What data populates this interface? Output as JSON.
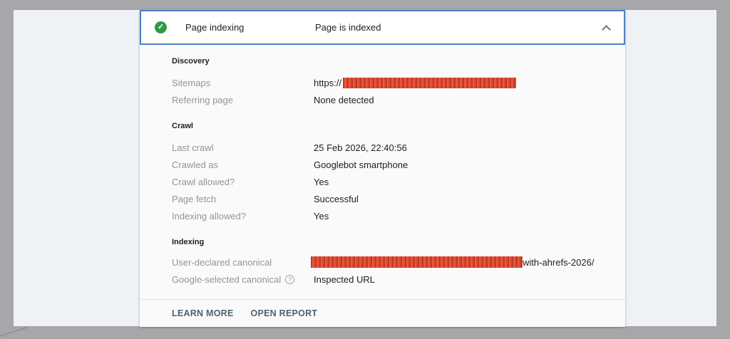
{
  "header": {
    "title": "Page indexing",
    "status": "Page is indexed",
    "check_icon_glyph": "✓",
    "colors": {
      "check_green": "#2d9a46",
      "border_blue": "#4e80c6"
    }
  },
  "sections": [
    {
      "heading": "Discovery",
      "rows": [
        {
          "label": "Sitemaps",
          "value_prefix": "https://",
          "redacted": true
        },
        {
          "label": "Referring page",
          "value": "None detected"
        }
      ]
    },
    {
      "heading": "Crawl",
      "rows": [
        {
          "label": "Last crawl",
          "value": "25 Feb 2026, 22:40:56"
        },
        {
          "label": "Crawled as",
          "value": "Googlebot smartphone"
        },
        {
          "label": "Crawl allowed?",
          "value": "Yes"
        },
        {
          "label": "Page fetch",
          "value": "Successful"
        },
        {
          "label": "Indexing allowed?",
          "value": "Yes"
        }
      ]
    },
    {
      "heading": "Indexing",
      "rows": [
        {
          "label": "User-declared canonical",
          "redacted": true,
          "value_suffix": "with-ahrefs-2026/"
        },
        {
          "label": "Google-selected canonical",
          "help_glyph": "?",
          "value": "Inspected URL"
        }
      ]
    }
  ],
  "footer": {
    "learn_more": "LEARN MORE",
    "open_report": "OPEN REPORT"
  },
  "colors": {
    "redaction_red": "#e2472e",
    "page_bg": "#eef1f6",
    "outer_bg": "#a7a7aa",
    "card_bg": "#fafafa",
    "label_gray": "#90959b",
    "value_dark": "#202124",
    "footer_link": "#4c6270"
  }
}
